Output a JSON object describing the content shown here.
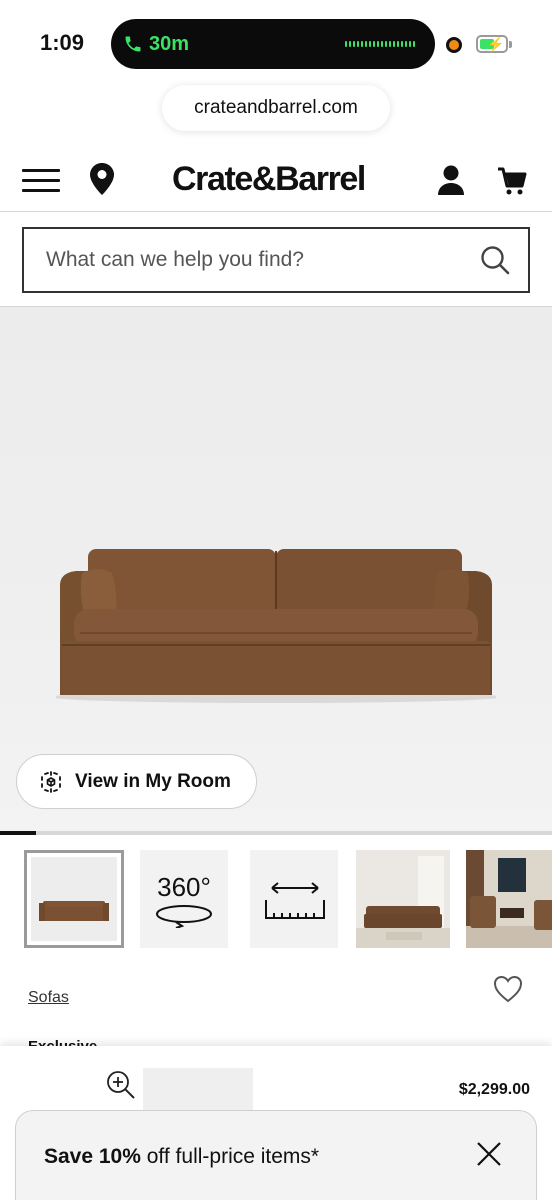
{
  "status_bar": {
    "time": "1:09",
    "call_duration": "30m"
  },
  "browser": {
    "url": "crateandbarrel.com"
  },
  "header": {
    "logo": "Crate&Barrel",
    "menu_icon": "hamburger-icon",
    "location_icon": "map-pin-icon",
    "account_icon": "user-icon",
    "cart_icon": "cart-icon"
  },
  "search": {
    "placeholder": "What can we help you find?"
  },
  "hero": {
    "view_in_room_label": "View in My Room",
    "gallery_progress": 0.066
  },
  "thumbnails": {
    "label_360": "360°",
    "items": [
      "sofa-front",
      "360-view",
      "dimensions",
      "room-scene-1",
      "room-scene-2"
    ]
  },
  "product": {
    "category_link": "Sofas",
    "badge": "Exclusive",
    "price": "$2,299.00"
  },
  "promo": {
    "bold": "Save 10%",
    "rest": " off full-price items*"
  },
  "colors": {
    "accent_green": "#3be266",
    "sofa_brown": "#7a5132",
    "text": "#111111"
  }
}
